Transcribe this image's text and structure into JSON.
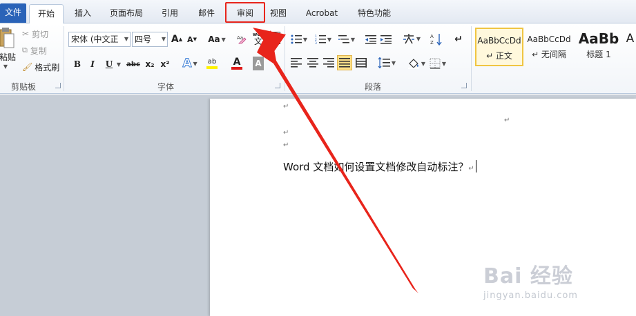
{
  "tabs": {
    "file": "文件",
    "home": "开始",
    "insert": "插入",
    "layout": "页面布局",
    "references": "引用",
    "mailings": "邮件",
    "review": "审阅",
    "view": "视图",
    "acrobat": "Acrobat",
    "special": "特色功能"
  },
  "clipboard": {
    "paste": "粘贴",
    "cut": "剪切",
    "copy": "复制",
    "format_painter": "格式刷",
    "label": "剪贴板"
  },
  "font": {
    "name": "宋体 (中文正",
    "size": "四号",
    "grow": "A",
    "shrink": "A",
    "case": "Aa",
    "pinyin": "wén",
    "border_char": "A",
    "bold": "B",
    "italic": "I",
    "underline": "U",
    "strike": "abc",
    "subscript": "x₂",
    "superscript": "x²",
    "effects": "A",
    "highlight": "ab",
    "color": "A",
    "shading": "A",
    "label": "字体"
  },
  "paragraph": {
    "label": "段落"
  },
  "styles": {
    "items": [
      {
        "preview": "AaBbCcDd",
        "name": "↵ 正文"
      },
      {
        "preview": "AaBbCcDd",
        "name": "↵ 无间隔"
      },
      {
        "preview": "AaBb",
        "name": "标题 1"
      },
      {
        "preview": "A",
        "name": ""
      }
    ]
  },
  "document": {
    "text": "Word 文档如何设置文档修改自动标注？",
    "para_mark": "↵"
  },
  "watermark": {
    "logo": "Bai 经验",
    "url": "jingyan.baidu.com"
  },
  "colors": {
    "accent": "#2a63b8",
    "highlight_box": "#e8241b",
    "arrow": "#e8241b",
    "workspace": "#c6cdd6"
  }
}
